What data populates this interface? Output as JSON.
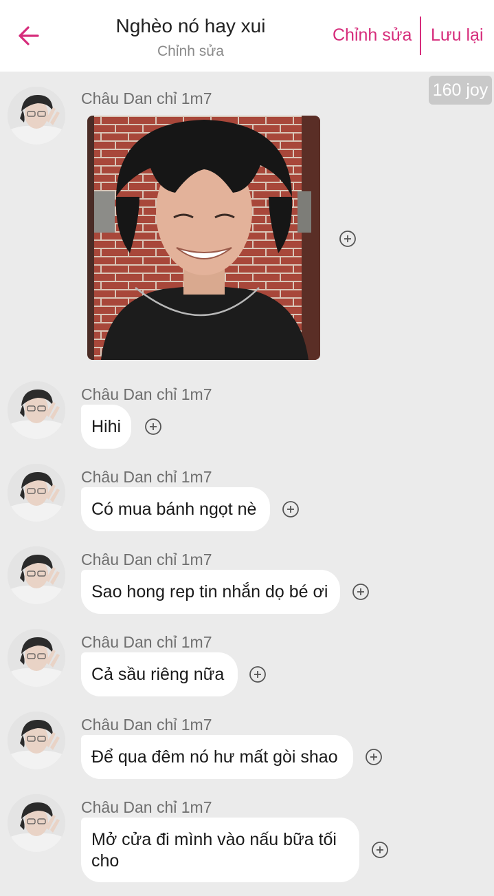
{
  "header": {
    "title": "Nghèo nó hay xui",
    "subtitle": "Chỉnh sửa",
    "edit_label": "Chỉnh sửa",
    "save_label": "Lưu lại"
  },
  "badge": {
    "text": "160 joy"
  },
  "colors": {
    "accent": "#d62c7b",
    "background": "#ebebeb",
    "bubble": "#ffffff"
  },
  "messages": [
    {
      "sender": "Châu Dan chỉ 1m7",
      "type": "image"
    },
    {
      "sender": "Châu Dan chỉ 1m7",
      "text": "Hihi"
    },
    {
      "sender": "Châu Dan chỉ 1m7",
      "text": "Có mua bánh ngọt nè"
    },
    {
      "sender": "Châu Dan chỉ 1m7",
      "text": "Sao hong rep tin nhắn dọ bé ơi"
    },
    {
      "sender": "Châu Dan chỉ 1m7",
      "text": "Cả sầu riêng nữa"
    },
    {
      "sender": "Châu Dan chỉ 1m7",
      "text": "Để qua đêm nó hư mất gòi shao"
    },
    {
      "sender": "Châu Dan chỉ 1m7",
      "text": "Mở cửa đi mình vào nấu bữa tối cho"
    }
  ]
}
